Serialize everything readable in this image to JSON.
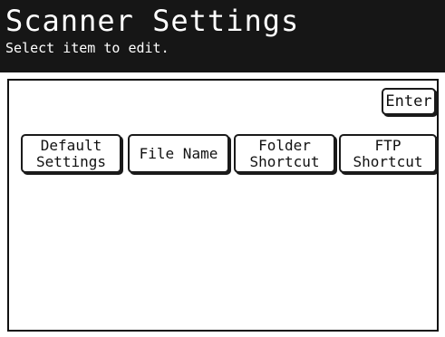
{
  "header": {
    "title": "Scanner Settings",
    "subtitle": "Select item to edit."
  },
  "actions": {
    "enter_label": "Enter"
  },
  "options": [
    {
      "label": "Default\nSettings"
    },
    {
      "label": "File Name"
    },
    {
      "label": "Folder\nShortcut"
    },
    {
      "label": "FTP\nShortcut"
    }
  ],
  "colors": {
    "header_bg": "#161616",
    "header_text": "#ffffff",
    "panel_border": "#111111",
    "button_border": "#1a1a1a"
  }
}
